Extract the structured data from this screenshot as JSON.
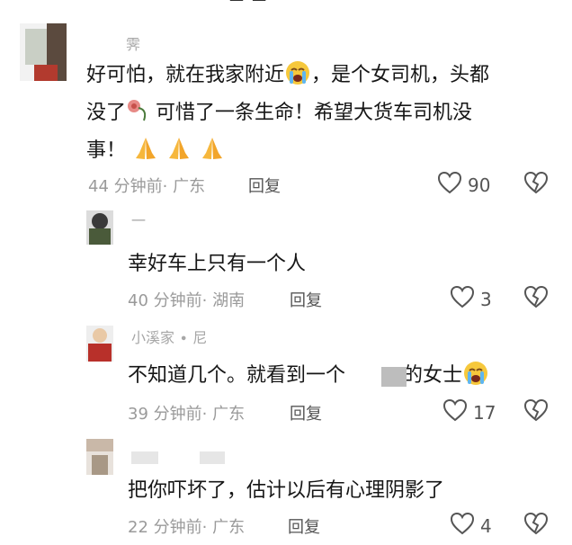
{
  "comments": [
    {
      "name": "霁",
      "text1": "好可怕，就在我家附近",
      "text2": "，是个女司机，头都",
      "text3": "没了",
      "text4": " 可惜了一条生命！希望大货车司机没",
      "text5": "事！",
      "time": "44 分钟前",
      "region": "· 广东",
      "reply": "回复",
      "likes": "90"
    },
    {
      "name": "一",
      "text": "幸好车上只有一个人",
      "time": "40 分钟前",
      "region": "· 湖南",
      "reply": "回复",
      "likes": "3"
    },
    {
      "name": "小溪家 ∙ 尼",
      "text1": "不知道几个。就看到一个",
      "text2": "的女士",
      "time": "39 分钟前",
      "region": "· 广东",
      "reply": "回复",
      "likes": "17"
    },
    {
      "name": "",
      "text": "把你吓坏了，估计以后有心理阴影了",
      "time": "22 分钟前",
      "region": "· 广东",
      "reply": "回复",
      "likes": "4"
    }
  ],
  "icons": {
    "like": "heart-outline-icon",
    "dislike": "broken-heart-icon",
    "cry": "loudly-crying-face-emoji",
    "rose": "wilted-rose-emoji",
    "pray": "folded-hands-emoji"
  },
  "colors": {
    "text": "#161616",
    "meta": "#9a9a9a",
    "icon": "#555555"
  }
}
